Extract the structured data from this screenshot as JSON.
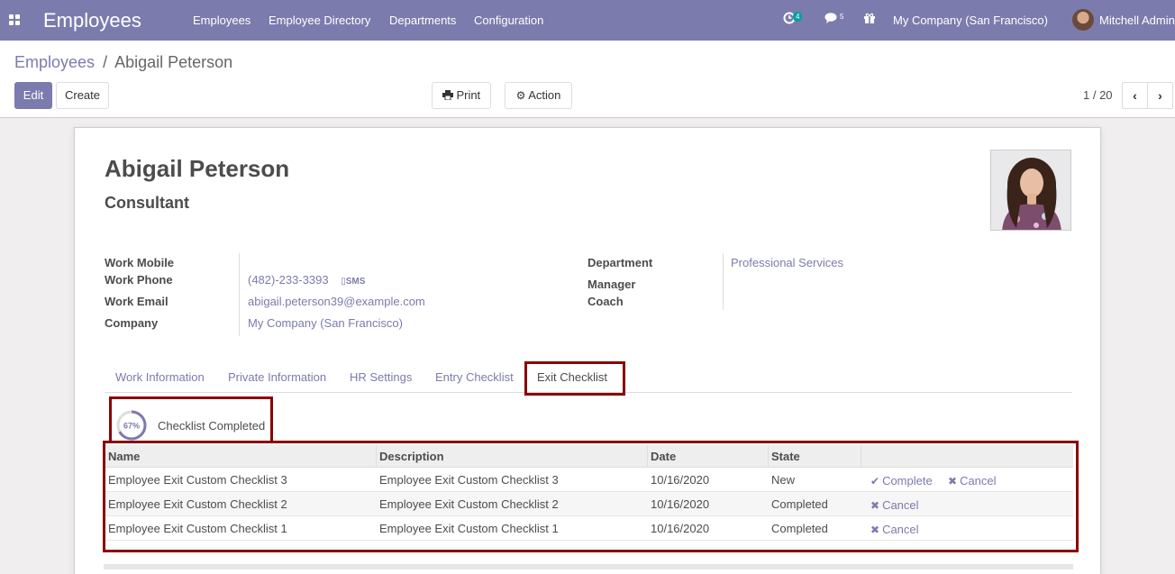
{
  "navbar": {
    "app_title": "Employees",
    "menu": [
      "Employees",
      "Employee Directory",
      "Departments",
      "Configuration"
    ],
    "activity_count": "4",
    "message_count": "5",
    "company": "My Company (San Francisco)",
    "user": "Mitchell Admin",
    "icons": [
      "apps-icon",
      "clock-icon",
      "chat-icon",
      "gift-icon"
    ]
  },
  "control": {
    "breadcrumb_parent": "Employees",
    "breadcrumb_sep": "/",
    "breadcrumb_current": "Abigail Peterson",
    "edit_label": "Edit",
    "create_label": "Create",
    "print_label": "Print",
    "action_label": "Action",
    "pager": "1 / 20"
  },
  "employee": {
    "name": "Abigail Peterson",
    "job_title": "Consultant",
    "fields_left": [
      {
        "label": "Work Mobile",
        "value": ""
      },
      {
        "label": "Work Phone",
        "value": "(482)-233-3393"
      },
      {
        "label": "Work Email",
        "value": "abigail.peterson39@example.com"
      },
      {
        "label": "Company",
        "value": "My Company (San Francisco)"
      }
    ],
    "sms_label": "SMS",
    "fields_right": [
      {
        "label": "Department",
        "value": "Professional Services"
      },
      {
        "label": "Manager",
        "value": ""
      },
      {
        "label": "Coach",
        "value": ""
      }
    ]
  },
  "tabs": [
    "Work Information",
    "Private Information",
    "HR Settings",
    "Entry Checklist",
    "Exit Checklist"
  ],
  "active_tab": "Exit Checklist",
  "checklist_progress": {
    "percent": 67,
    "percent_label": "67%",
    "label": "Checklist Completed"
  },
  "table": {
    "columns": [
      "Name",
      "Description",
      "Date",
      "State"
    ],
    "rows": [
      {
        "name": "Employee Exit Custom Checklist 3",
        "description": "Employee Exit Custom Checklist 3",
        "date": "10/16/2020",
        "state": "New",
        "actions": [
          "Complete",
          "Cancel"
        ]
      },
      {
        "name": "Employee Exit Custom Checklist 2",
        "description": "Employee Exit Custom Checklist 2",
        "date": "10/16/2020",
        "state": "Completed",
        "actions": [
          "Cancel"
        ]
      },
      {
        "name": "Employee Exit Custom Checklist 1",
        "description": "Employee Exit Custom Checklist 1",
        "date": "10/16/2020",
        "state": "Completed",
        "actions": [
          "Cancel"
        ]
      }
    ]
  },
  "colors": {
    "brand": "#7c7bad",
    "highlight": "#8b0000",
    "activity_badge": "#00a09d"
  }
}
